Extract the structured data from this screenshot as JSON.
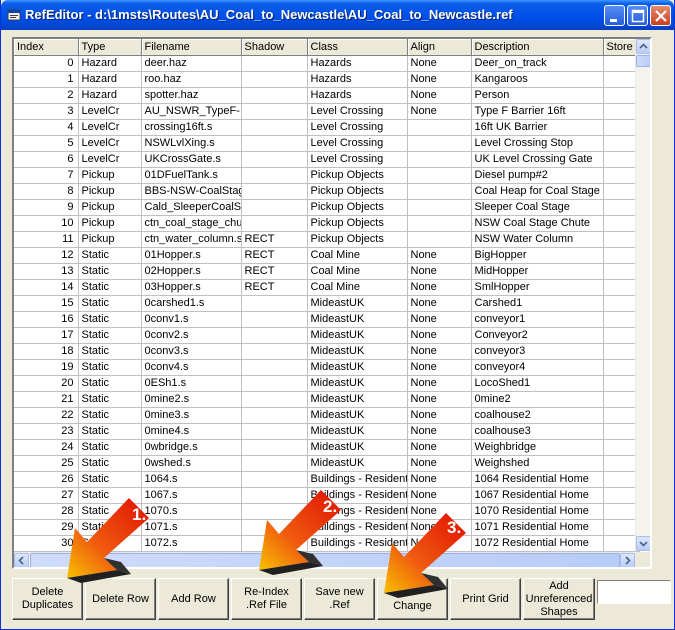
{
  "window": {
    "title": "RefEditor - d:\\1msts\\Routes\\AU_Coal_to_Newcastle\\AU_Coal_to_Newcastle.ref",
    "controls": {
      "minimize": "minimize",
      "maximize": "maximize",
      "close": "close"
    }
  },
  "grid": {
    "columns": [
      "Index",
      "Type",
      "Filename",
      "Shadow",
      "Class",
      "Align",
      "Description",
      "Store"
    ],
    "rows": [
      [
        "0",
        "Hazard",
        "deer.haz",
        "",
        "Hazards",
        "None",
        "Deer_on_track"
      ],
      [
        "1",
        "Hazard",
        "roo.haz",
        "",
        "Hazards",
        "None",
        "Kangaroos"
      ],
      [
        "2",
        "Hazard",
        "spotter.haz",
        "",
        "Hazards",
        "None",
        "Person"
      ],
      [
        "3",
        "LevelCr",
        "AU_NSWR_TypeF-",
        "",
        "Level Crossing",
        "None",
        "Type F Barrier 16ft"
      ],
      [
        "4",
        "LevelCr",
        "crossing16ft.s",
        "",
        "Level Crossing",
        "",
        "16ft UK Barrier"
      ],
      [
        "5",
        "LevelCr",
        "NSWLvlXing.s",
        "",
        "Level Crossing",
        "",
        "Level Crossing Stop"
      ],
      [
        "6",
        "LevelCr",
        "UKCrossGate.s",
        "",
        "Level Crossing",
        "",
        "UK Level Crossing Gate"
      ],
      [
        "7",
        "Pickup",
        "01DFuelTank.s",
        "",
        "Pickup Objects",
        "",
        "Diesel pump#2"
      ],
      [
        "8",
        "Pickup",
        "BBS-NSW-CoalStag",
        "",
        "Pickup Objects",
        "",
        "Coal Heap for Coal Stage"
      ],
      [
        "9",
        "Pickup",
        "Cald_SleeperCoalSt",
        "",
        "Pickup Objects",
        "",
        "Sleeper Coal Stage"
      ],
      [
        "10",
        "Pickup",
        "ctn_coal_stage_chu",
        "",
        "Pickup Objects",
        "",
        "NSW Coal Stage Chute"
      ],
      [
        "11",
        "Pickup",
        "ctn_water_column.s",
        "RECT",
        "Pickup Objects",
        "",
        "NSW Water Column"
      ],
      [
        "12",
        "Static",
        "01Hopper.s",
        "RECT",
        "Coal Mine",
        "None",
        "BigHopper"
      ],
      [
        "13",
        "Static",
        "02Hopper.s",
        "RECT",
        "Coal Mine",
        "None",
        "MidHopper"
      ],
      [
        "14",
        "Static",
        "03Hopper.s",
        "RECT",
        "Coal Mine",
        "None",
        "SmlHopper"
      ],
      [
        "15",
        "Static",
        "0carshed1.s",
        "",
        "MideastUK",
        "None",
        "Carshed1"
      ],
      [
        "16",
        "Static",
        "0conv1.s",
        "",
        "MideastUK",
        "None",
        "conveyor1"
      ],
      [
        "17",
        "Static",
        "0conv2.s",
        "",
        "MideastUK",
        "None",
        "Conveyor2"
      ],
      [
        "18",
        "Static",
        "0conv3.s",
        "",
        "MideastUK",
        "None",
        "conveyor3"
      ],
      [
        "19",
        "Static",
        "0conv4.s",
        "",
        "MideastUK",
        "None",
        "conveyor4"
      ],
      [
        "20",
        "Static",
        "0ESh1.s",
        "",
        "MideastUK",
        "None",
        "LocoShed1"
      ],
      [
        "21",
        "Static",
        "0mine2.s",
        "",
        "MideastUK",
        "None",
        "0mine2"
      ],
      [
        "22",
        "Static",
        "0mine3.s",
        "",
        "MideastUK",
        "None",
        "coalhouse2"
      ],
      [
        "23",
        "Static",
        "0mine4.s",
        "",
        "MideastUK",
        "None",
        "coalhouse3"
      ],
      [
        "24",
        "Static",
        "0wbridge.s",
        "",
        "MideastUK",
        "None",
        "Weighbridge"
      ],
      [
        "25",
        "Static",
        "0wshed.s",
        "",
        "MideastUK",
        "None",
        "Weighshed"
      ],
      [
        "26",
        "Static",
        "1064.s",
        "",
        "Buildings - Resident",
        "None",
        "1064 Residential Home"
      ],
      [
        "27",
        "Static",
        "1067.s",
        "",
        "Buildings - Resident",
        "None",
        "1067 Residential Home"
      ],
      [
        "28",
        "Static",
        "1070.s",
        "",
        "Buildings - Resident",
        "None",
        "1070 Residential Home"
      ],
      [
        "29",
        "Static",
        "1071.s",
        "",
        "Buildings - Resident",
        "None",
        "1071 Residential Home"
      ],
      [
        "30",
        "Static",
        "1072.s",
        "",
        "Buildings - Resident",
        "None",
        "1072 Residential Home"
      ]
    ]
  },
  "buttons": [
    "Delete\nDuplicates",
    "Delete Row",
    "Add Row",
    "Re-Index\n.Ref File",
    "Save new\n.Ref",
    "Change",
    "Print Grid",
    "Add\nUnreferenced\nShapes"
  ],
  "callouts": [
    "1.",
    "2.",
    "3."
  ],
  "colors": {
    "titlebar": "#0050ea",
    "arrow_red": "#e01000",
    "arrow_orange": "#f7a000"
  }
}
